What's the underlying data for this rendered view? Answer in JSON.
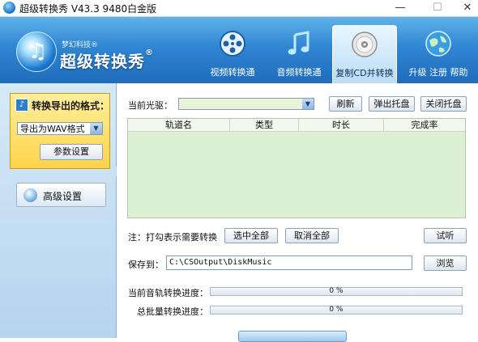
{
  "window": {
    "title": "超级转换秀 V43.3 9480白金版",
    "min_glyph": "—",
    "max_glyph": "☐",
    "close_glyph": "✕"
  },
  "brand": {
    "small": "梦幻科技®",
    "big": "超级转换秀",
    "reg": "®"
  },
  "nav": {
    "video": "视频转换通",
    "audio": "音频转换通",
    "cd": "复制CD并转换",
    "help": "升级 注册 帮助"
  },
  "sidebar": {
    "export_title": "转换导出的格式：",
    "export_format": "导出为WAV格式",
    "param_button": "参数设置",
    "advanced_button": "高级设置"
  },
  "main": {
    "drive_label": "当前光驱：",
    "drive_value": "",
    "refresh": "刷新",
    "eject": "弹出托盘",
    "close_tray": "关闭托盘",
    "columns": [
      "轨道名",
      "类型",
      "时长",
      "完成率"
    ],
    "hint": "注：打勾表示需要转换",
    "select_all": "选中全部",
    "cancel_all": "取消全部",
    "preview": "试听",
    "save_to_label": "保存到：",
    "save_path": "C:\\CSOutput\\DiskMusic",
    "browse": "浏览",
    "track_progress_label": "当前音轨转换进度：",
    "track_progress_value": 0,
    "track_progress_text": "0 %",
    "batch_progress_label": "总批量转换进度：",
    "batch_progress_value": 0,
    "batch_progress_text": "0 %"
  },
  "colors": {
    "header_top": "#5fb2ea",
    "header_bottom": "#1f6cbb",
    "sidebar": "#c8e0f3",
    "table_bg": "#dcf0d4",
    "export_box": "#ffdf6a"
  }
}
